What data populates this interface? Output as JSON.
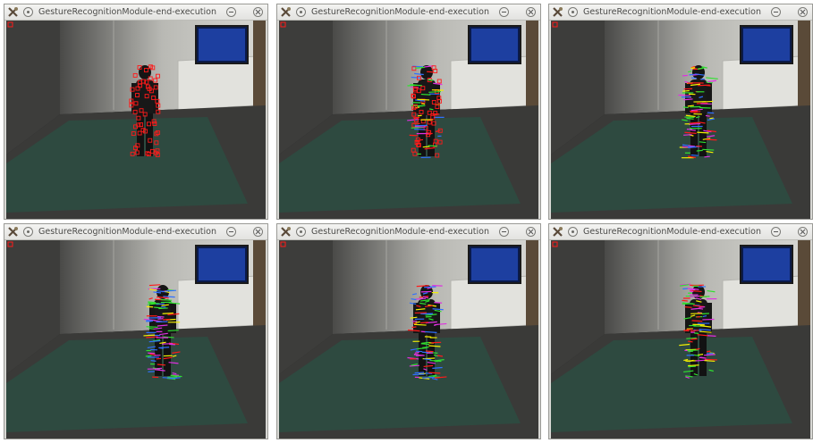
{
  "windows": [
    {
      "title": "GestureRecognitionModule-end-execution",
      "features": "red"
    },
    {
      "title": "GestureRecognitionModule-end-execution",
      "features": "mixed"
    },
    {
      "title": "GestureRecognitionModule-end-execution",
      "features": "colored"
    },
    {
      "title": "GestureRecognitionModule-end-execution",
      "features": "colored"
    },
    {
      "title": "GestureRecognitionModule-end-execution",
      "features": "colored"
    },
    {
      "title": "GestureRecognitionModule-end-execution",
      "features": "colored"
    }
  ],
  "icons": {
    "app": "tools-icon",
    "menu": "window-menu-icon",
    "minimize": "minimize-icon",
    "close": "close-icon"
  },
  "colors": {
    "feature_red": "#ff1a1a",
    "feature_yellow": "#f5f000",
    "feature_green": "#30e030",
    "feature_magenta": "#e030e0",
    "feature_blue": "#3070ff",
    "floor_mat": "#2e4a40"
  }
}
